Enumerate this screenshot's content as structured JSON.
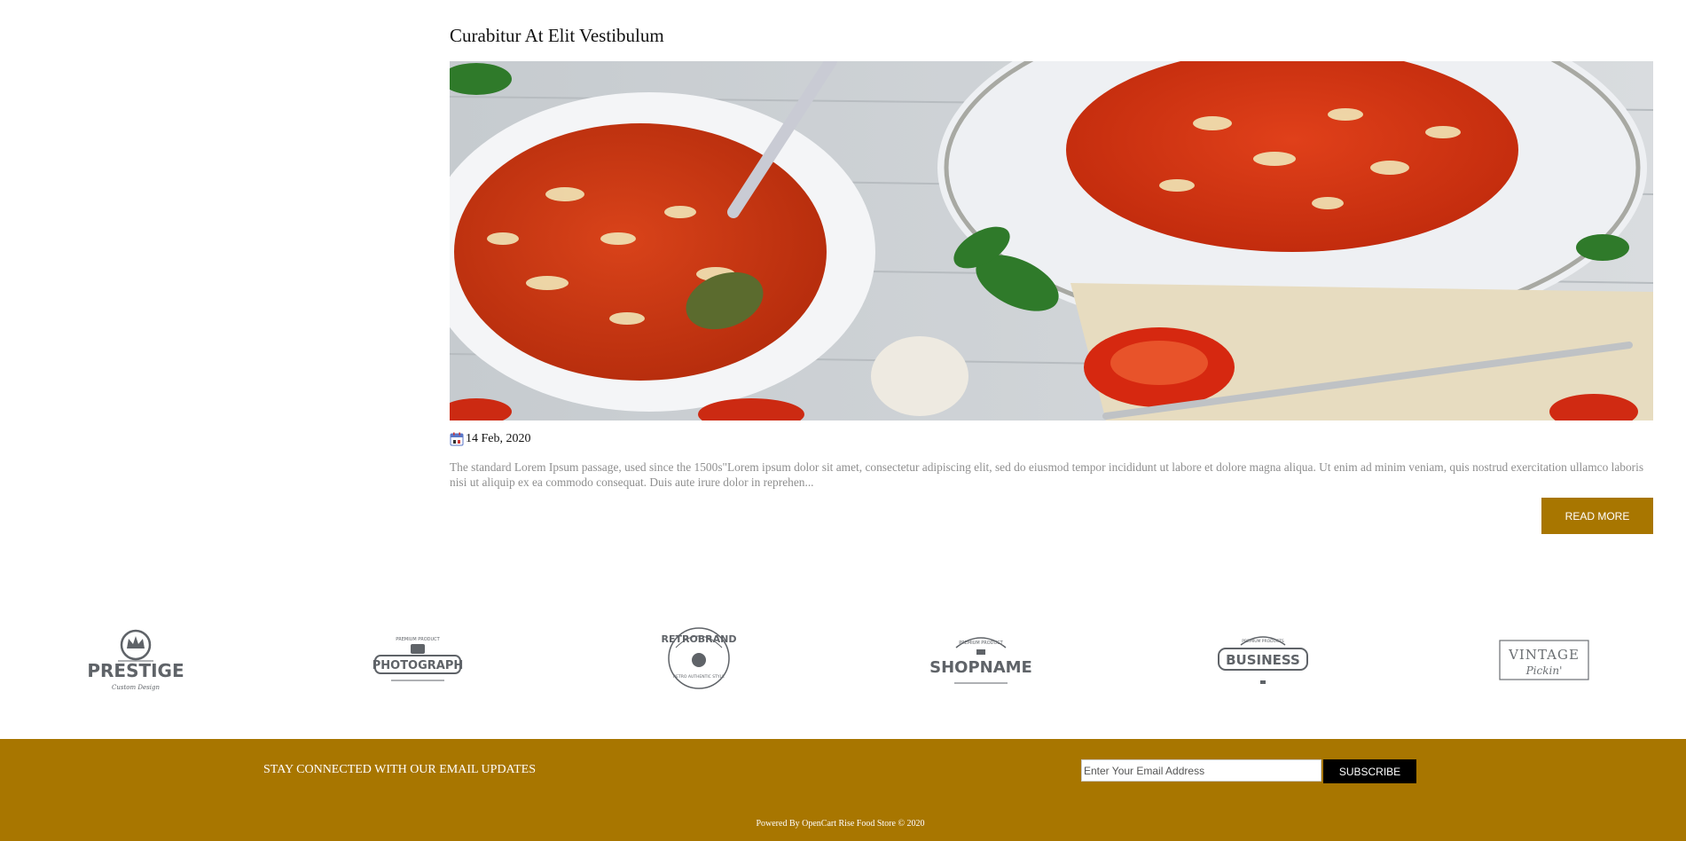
{
  "post": {
    "title": "Curabitur At Elit Vestibulum",
    "date": "14 Feb, 2020",
    "excerpt": "The standard Lorem Ipsum passage, used since the 1500s\"Lorem ipsum dolor sit amet, consectetur adipiscing elit, sed do eiusmod tempor incididunt ut labore et dolore magna aliqua. Ut enim ad minim veniam, quis nostrud exercitation ullamco laboris nisi ut aliquip ex ea commodo consequat. Duis aute irure dolor in reprehen...",
    "read_more_label": "READ MORE",
    "image_icon": "tomato-pasta-soup-photo",
    "date_icon": "calendar-icon"
  },
  "brands": [
    {
      "name": "PRESTIGE",
      "tagline": "Custom Design",
      "icon": "crown-icon"
    },
    {
      "name": "PHOTOGRAPH",
      "tagline": "PREMIUM PRODUCT",
      "icon": "camera-icon"
    },
    {
      "name": "RETROBRAND",
      "tagline": "RETRO AUTHENTIC STYLE",
      "icon": "apple-icon"
    },
    {
      "name": "SHOPNAME",
      "tagline": "PREMIUM PRODUCT",
      "icon": "badge-icon"
    },
    {
      "name": "BUSINESS",
      "tagline": "PREMIUM PRODUCTS",
      "icon": "badge-icon"
    },
    {
      "name": "VINTAGE",
      "tagline": "Pickin'",
      "icon": "frame-icon"
    }
  ],
  "footer": {
    "newsletter_label": "STAY CONNECTED WITH OUR EMAIL UPDATES",
    "email_placeholder": "Enter Your Email Address",
    "subscribe_label": "SUBSCRIBE",
    "copyright": "Powered By OpenCart Rise Food Store © 2020"
  },
  "colors": {
    "accent": "#a87600",
    "subscribe_button": "#000000",
    "excerpt_text": "#8f8f8f",
    "logo_gray": "#5f6368"
  }
}
